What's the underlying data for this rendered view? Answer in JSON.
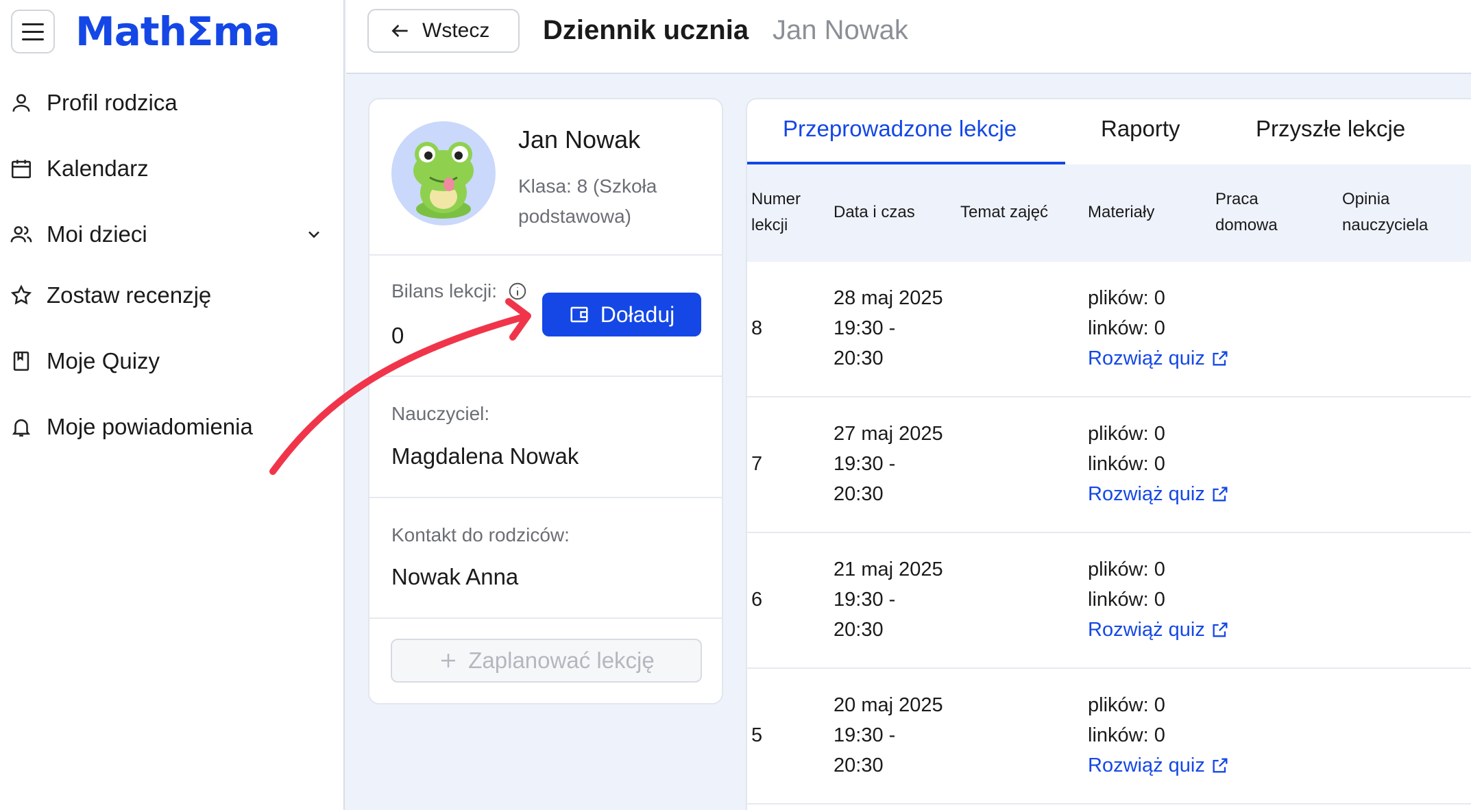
{
  "sidebar": {
    "logo": "MathΣma",
    "items": [
      {
        "label": "Profil rodzica",
        "icon": "user-icon"
      },
      {
        "label": "Kalendarz",
        "icon": "calendar-icon"
      },
      {
        "label": "Moi dzieci",
        "icon": "users-icon"
      },
      {
        "label": "Zostaw recenzję",
        "icon": "star-icon"
      },
      {
        "label": "Moje Quizy",
        "icon": "book-icon"
      },
      {
        "label": "Moje powiadomienia",
        "icon": "bell-icon"
      }
    ]
  },
  "header": {
    "back_label": "Wstecz",
    "title": "Dziennik ucznia",
    "student_name": "Jan Nowak"
  },
  "student": {
    "name": "Jan Nowak",
    "class": "Klasa: 8 (Szkoła podstawowa)",
    "balance_label": "Bilans lekcji:",
    "balance_value": "0",
    "topup_label": "Doładuj",
    "teacher_label": "Nauczyciel:",
    "teacher_value": "Magdalena Nowak",
    "contact_label": "Kontakt do rodziców:",
    "contact_value": "Nowak Anna",
    "plan_label": "Zaplanować lekcję"
  },
  "tabs": [
    "Przeprowadzone lekcje",
    "Raporty",
    "Przyszłe lekcje"
  ],
  "table": {
    "headers": [
      "Numer lekcji",
      "Data i czas",
      "Temat zajęć",
      "Materiały",
      "Praca domowa",
      "Opinia nauczyciela"
    ],
    "rows": [
      {
        "num": "8",
        "date": "28 maj 2025",
        "time1": "19:30 -",
        "time2": "20:30",
        "files": "plików: 0",
        "links": "linków: 0",
        "quiz": "Rozwiąż quiz"
      },
      {
        "num": "7",
        "date": "27 maj 2025",
        "time1": "19:30 -",
        "time2": "20:30",
        "files": "plików: 0",
        "links": "linków: 0",
        "quiz": "Rozwiąż quiz"
      },
      {
        "num": "6",
        "date": "21 maj 2025",
        "time1": "19:30 -",
        "time2": "20:30",
        "files": "plików: 0",
        "links": "linków: 0",
        "quiz": "Rozwiąż quiz"
      },
      {
        "num": "5",
        "date": "20 maj 2025",
        "time1": "19:30 -",
        "time2": "20:30",
        "files": "plików: 0",
        "links": "linków: 0",
        "quiz": "Rozwiąż quiz"
      }
    ]
  },
  "colors": {
    "accent": "#1447e6",
    "arrow": "#f0354a",
    "page_bg": "#eef2fb"
  }
}
